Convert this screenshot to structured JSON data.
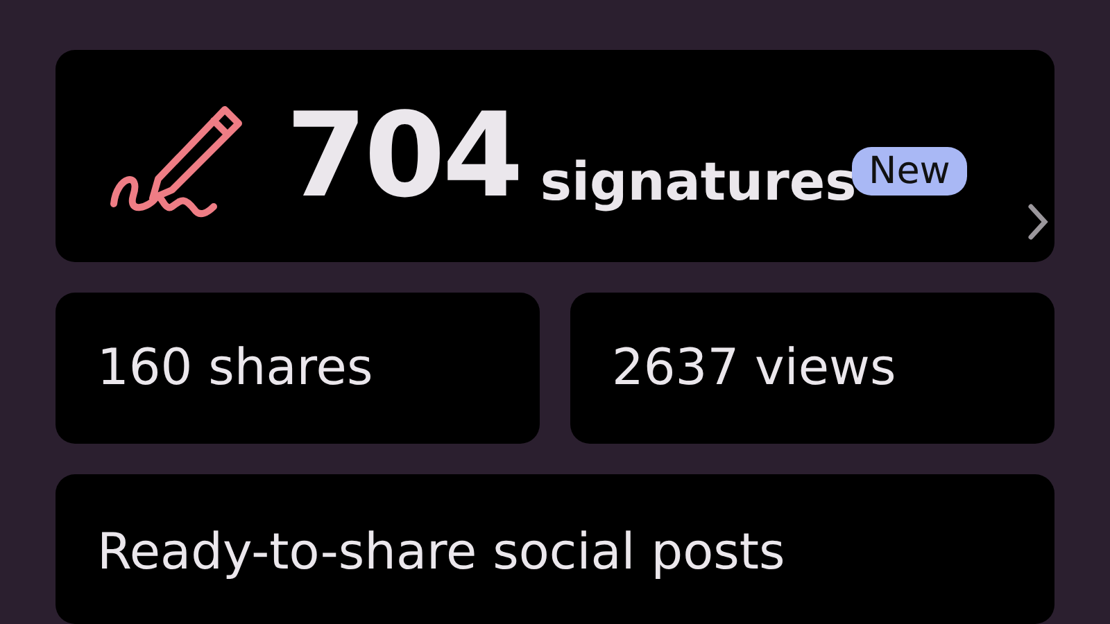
{
  "signatures": {
    "count": "704",
    "label": "signatures",
    "badge": "New"
  },
  "stats": [
    {
      "text": "160 shares"
    },
    {
      "text": "2637 views"
    }
  ],
  "social_posts": {
    "title": "Ready-to-share social posts"
  }
}
